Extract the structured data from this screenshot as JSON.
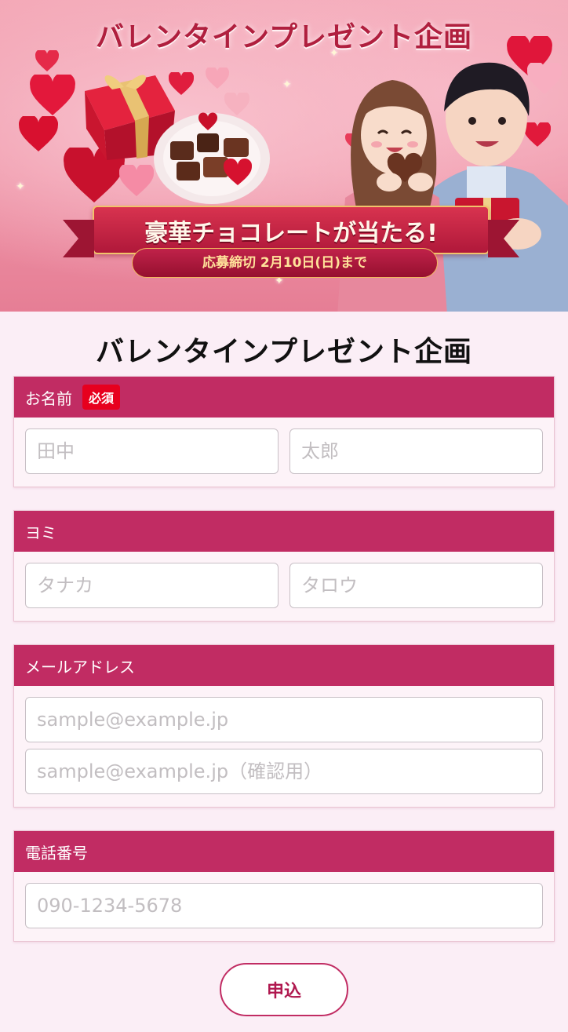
{
  "banner": {
    "title": "バレンタインプレゼント企画",
    "ribbon_text": "豪華チョコレートが当たる!",
    "deadline": "応募締切 2月10日(日)まで"
  },
  "page_title": "バレンタインプレゼント企画",
  "fields": {
    "name": {
      "label": "お名前",
      "required_badge": "必須",
      "last_placeholder": "田中",
      "first_placeholder": "太郎"
    },
    "kana": {
      "label": "ヨミ",
      "last_placeholder": "タナカ",
      "first_placeholder": "タロウ"
    },
    "email": {
      "label": "メールアドレス",
      "placeholder": "sample@example.jp",
      "confirm_placeholder": "sample@example.jp（確認用）"
    },
    "phone": {
      "label": "電話番号",
      "placeholder": "090-1234-5678"
    }
  },
  "submit_label": "申込",
  "colors": {
    "accent": "#c12c63",
    "required": "#e7001e",
    "background": "#fbeef6"
  }
}
